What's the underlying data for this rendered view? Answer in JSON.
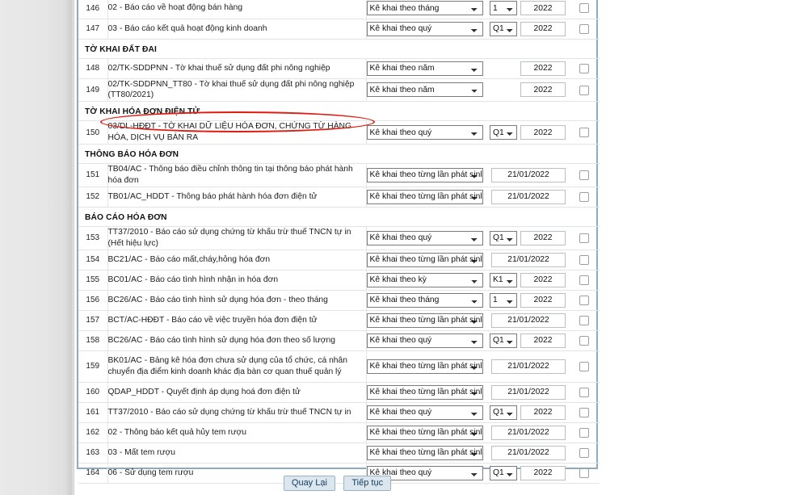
{
  "colors": {
    "annotation": "#e01b12",
    "panel_border": "#8fa9bd",
    "button_bg": "#dbe6ef",
    "button_text": "#17405e",
    "sidebar": "#e6e6e6"
  },
  "footer": {
    "back_label": "Quay Lại",
    "continue_label": "Tiếp tục"
  },
  "period_options": {
    "month": "Kê khai theo tháng",
    "quarter": "Kê khai theo quý",
    "year": "Kê khai theo năm",
    "each_time": "Kê khai theo từng lần phát sinh",
    "period": "Kê khai theo kỳ"
  },
  "table": {
    "rows": [
      {
        "kind": "data",
        "num": "146",
        "desc": "02 - Báo cáo về hoạt động bán hàng",
        "period": "Kê khai theo tháng",
        "sub": "1",
        "year": "2022",
        "checked": false
      },
      {
        "kind": "data",
        "num": "147",
        "desc": "03 - Báo cáo kết quả hoạt động kinh doanh",
        "period": "Kê khai theo quý",
        "sub": "Q1",
        "year": "2022",
        "checked": false
      },
      {
        "kind": "section",
        "title": "TỜ KHAI ĐẤT ĐAI"
      },
      {
        "kind": "data",
        "num": "148",
        "desc": "02/TK-SDDPNN - Tờ khai thuế sử dụng đất phi nông nghiệp",
        "period": "Kê khai theo năm",
        "sub": "",
        "year": "2022",
        "checked": false
      },
      {
        "kind": "data",
        "num": "149",
        "desc": "02/TK-SDDPNN_TT80 - Tờ khai thuế sử dụng đất phi nông nghiệp (TT80/2021)",
        "period": "Kê khai theo năm",
        "sub": "",
        "year": "2022",
        "checked": false
      },
      {
        "kind": "section",
        "title": "TỜ KHAI HÓA ĐƠN ĐIỆN TỬ"
      },
      {
        "kind": "data",
        "num": "150",
        "desc": "03/DL-HĐĐT - TỜ KHAI DỮ LIỆU HÓA ĐƠN, CHỨNG TỪ HÀNG HÓA, DỊCH VỤ BÁN RA",
        "period": "Kê khai theo quý",
        "sub": "Q1",
        "year": "2022",
        "checked": false,
        "highlight": true
      },
      {
        "kind": "section",
        "title": "THÔNG BÁO HÓA ĐƠN"
      },
      {
        "kind": "data",
        "num": "151",
        "desc": "TB04/AC - Thông báo điều chỉnh thông tin tại thông báo phát hành hóa đơn",
        "period": "Kê khai theo từng lần phát sinh",
        "date": "21/01/2022",
        "checked": false
      },
      {
        "kind": "data",
        "num": "152",
        "desc": "TB01/AC_HDDT - Thông báo phát hành hóa đơn điện tử",
        "period": "Kê khai theo từng lần phát sinh",
        "date": "21/01/2022",
        "checked": false
      },
      {
        "kind": "section",
        "title": "BÁO CÁO HÓA ĐƠN"
      },
      {
        "kind": "data",
        "num": "153",
        "desc": "TT37/2010 - Báo cáo sử dụng chứng từ khấu trừ thuế TNCN tự in (Hết hiệu lực)",
        "period": "Kê khai theo quý",
        "sub": "Q1",
        "year": "2022",
        "checked": false
      },
      {
        "kind": "data",
        "num": "154",
        "desc": "BC21/AC - Báo cáo mất,cháy,hỏng hóa đơn",
        "period": "Kê khai theo từng lần phát sinh",
        "date": "21/01/2022",
        "checked": false
      },
      {
        "kind": "data",
        "num": "155",
        "desc": "BC01/AC - Báo cáo tình hình nhận in hóa đơn",
        "period": "Kê khai theo kỳ",
        "sub": "K1",
        "year": "2022",
        "checked": false
      },
      {
        "kind": "data",
        "num": "156",
        "desc": "BC26/AC - Báo cáo tình hình sử dụng hóa đơn - theo tháng",
        "period": "Kê khai theo tháng",
        "sub": "1",
        "year": "2022",
        "checked": false
      },
      {
        "kind": "data",
        "num": "157",
        "desc": "BCT/AC-HĐĐT - Báo cáo về việc truyền hóa đơn điện tử",
        "period": "Kê khai theo từng lần phát sinh",
        "date": "21/01/2022",
        "checked": false
      },
      {
        "kind": "data",
        "num": "158",
        "desc": "BC26/AC - Báo cáo tình hình sử dụng hóa đơn theo số lượng",
        "period": "Kê khai theo quý",
        "sub": "Q1",
        "year": "2022",
        "checked": false
      },
      {
        "kind": "data",
        "num": "159",
        "desc": "BK01/AC - Bảng kê hóa đơn chưa sử dụng của tổ chức, cá nhân chuyển địa điểm kinh doanh khác địa bàn cơ quan thuế quản lý",
        "period": "Kê khai theo từng lần phát sinh",
        "date": "21/01/2022",
        "checked": false,
        "tall": true
      },
      {
        "kind": "data",
        "num": "160",
        "desc": "QDAP_HDDT - Quyết định áp dụng hoá đơn điện tử",
        "period": "Kê khai theo từng lần phát sinh",
        "date": "21/01/2022",
        "checked": false
      },
      {
        "kind": "data",
        "num": "161",
        "desc": "TT37/2010 - Báo cáo sử dụng chứng từ khấu trừ thuế TNCN tự in",
        "period": "Kê khai theo quý",
        "sub": "Q1",
        "year": "2022",
        "checked": false
      },
      {
        "kind": "data",
        "num": "162",
        "desc": "02 - Thông báo kết quả hủy tem rượu",
        "period": "Kê khai theo từng lần phát sinh",
        "date": "21/01/2022",
        "checked": false
      },
      {
        "kind": "data",
        "num": "163",
        "desc": "03 - Mất tem rượu",
        "period": "Kê khai theo từng lần phát sinh",
        "date": "21/01/2022",
        "checked": false
      },
      {
        "kind": "data",
        "num": "164",
        "desc": "06 - Sử dụng tem rượu",
        "period": "Kê khai theo quý",
        "sub": "Q1",
        "year": "2022",
        "checked": false
      }
    ]
  }
}
